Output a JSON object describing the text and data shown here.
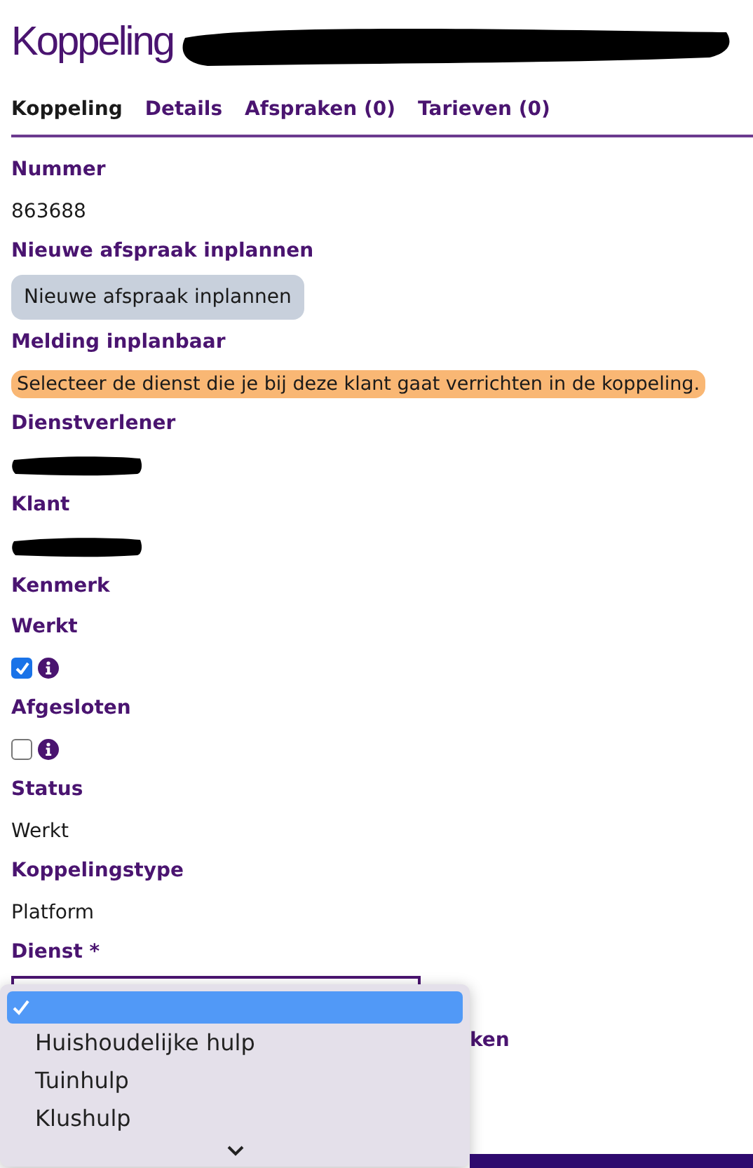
{
  "page_title": {
    "text": "Koppeling",
    "redacted_suffix": true
  },
  "tabs": [
    {
      "label": "Koppeling",
      "selected": true
    },
    {
      "label": "Details",
      "selected": false
    },
    {
      "label": "Afspraken (0)",
      "selected": false
    },
    {
      "label": "Tarieven (0)",
      "selected": false
    }
  ],
  "fields": [
    {
      "label": "Nummer",
      "kind": "text",
      "value": "863688"
    },
    {
      "label": "Nieuwe afspraak inplannen",
      "kind": "button",
      "value": "Nieuwe afspraak inplannen"
    },
    {
      "label": "Melding inplanbaar",
      "kind": "notice",
      "value": "Selecteer de dienst die je bij deze klant gaat verrichten in de koppeling."
    },
    {
      "label": "Dienstverlener",
      "kind": "redacted"
    },
    {
      "label": "Klant",
      "kind": "redacted"
    },
    {
      "label": "Kenmerk",
      "kind": "empty"
    },
    {
      "label": "Werkt",
      "kind": "checkbox",
      "checked": true
    },
    {
      "label": "Afgesloten",
      "kind": "checkbox",
      "checked": false
    },
    {
      "label": "Status",
      "kind": "text",
      "value": "Werkt"
    },
    {
      "label": "Koppelingstype",
      "kind": "text",
      "value": "Platform"
    },
    {
      "label": "Dienst *",
      "kind": "select"
    }
  ],
  "hidden_label": "ken",
  "dropdown": {
    "options": [
      {
        "selected": true
      },
      {
        "label": "Huishoudelijke hulp",
        "selected": false
      },
      {
        "label": "Tuinhulp",
        "selected": false
      },
      {
        "label": "Klushulp",
        "selected": false
      }
    ]
  }
}
